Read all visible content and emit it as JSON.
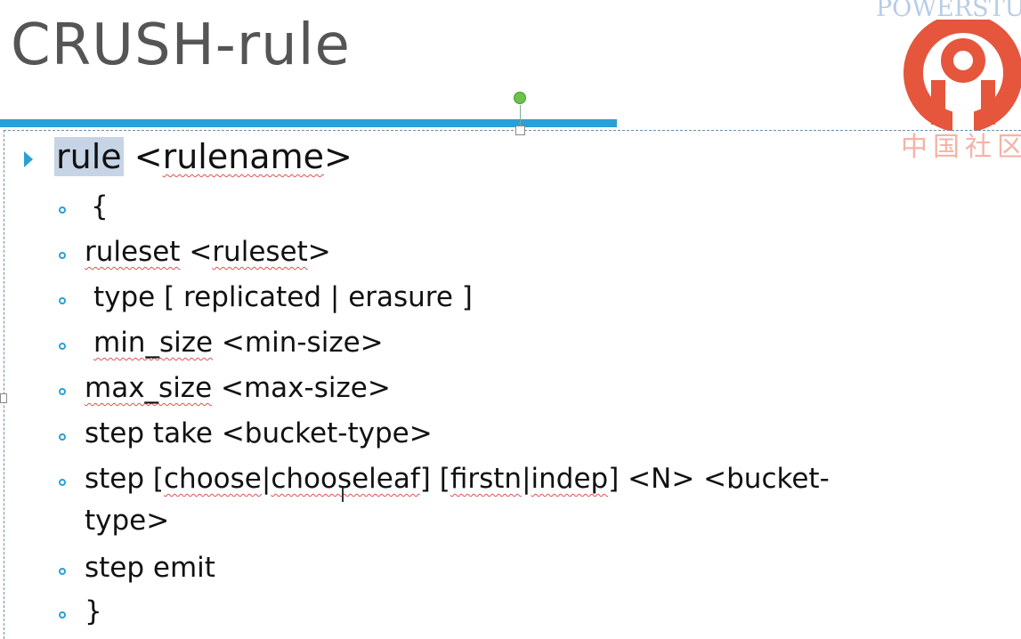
{
  "slide": {
    "title": "CRUSH-rule"
  },
  "watermark": {
    "text": "POWERSTUD",
    "cn_text": "中国社区",
    "logo_color": "#e5563c"
  },
  "colors": {
    "accent": "#2aa0d6",
    "title": "#555555",
    "highlight": "#c6d4e6"
  },
  "lines": {
    "l0_a": "rule",
    "l0_b": " <",
    "l0_c": "rulename",
    "l0_d": ">",
    "l1": "{",
    "l2_a": "ruleset",
    "l2_b": " <",
    "l2_c": "ruleset",
    "l2_d": ">",
    "l3": "type [ replicated | erasure ]",
    "l4_a": "min_size",
    "l4_b": " <min-size>",
    "l5_a": "max_size",
    "l5_b": " <max-size>",
    "l6": "step take <bucket-type>",
    "l7_a": "step [",
    "l7_b": "choose",
    "l7_c": "|",
    "l7_d": "chooseleaf",
    "l7_e": "] [",
    "l7_f": "firstn",
    "l7_g": "|",
    "l7_h": "indep",
    "l7_i": "] <N> <bucket-",
    "l7_cont": "type>",
    "l8": "step emit",
    "l9": "}"
  }
}
